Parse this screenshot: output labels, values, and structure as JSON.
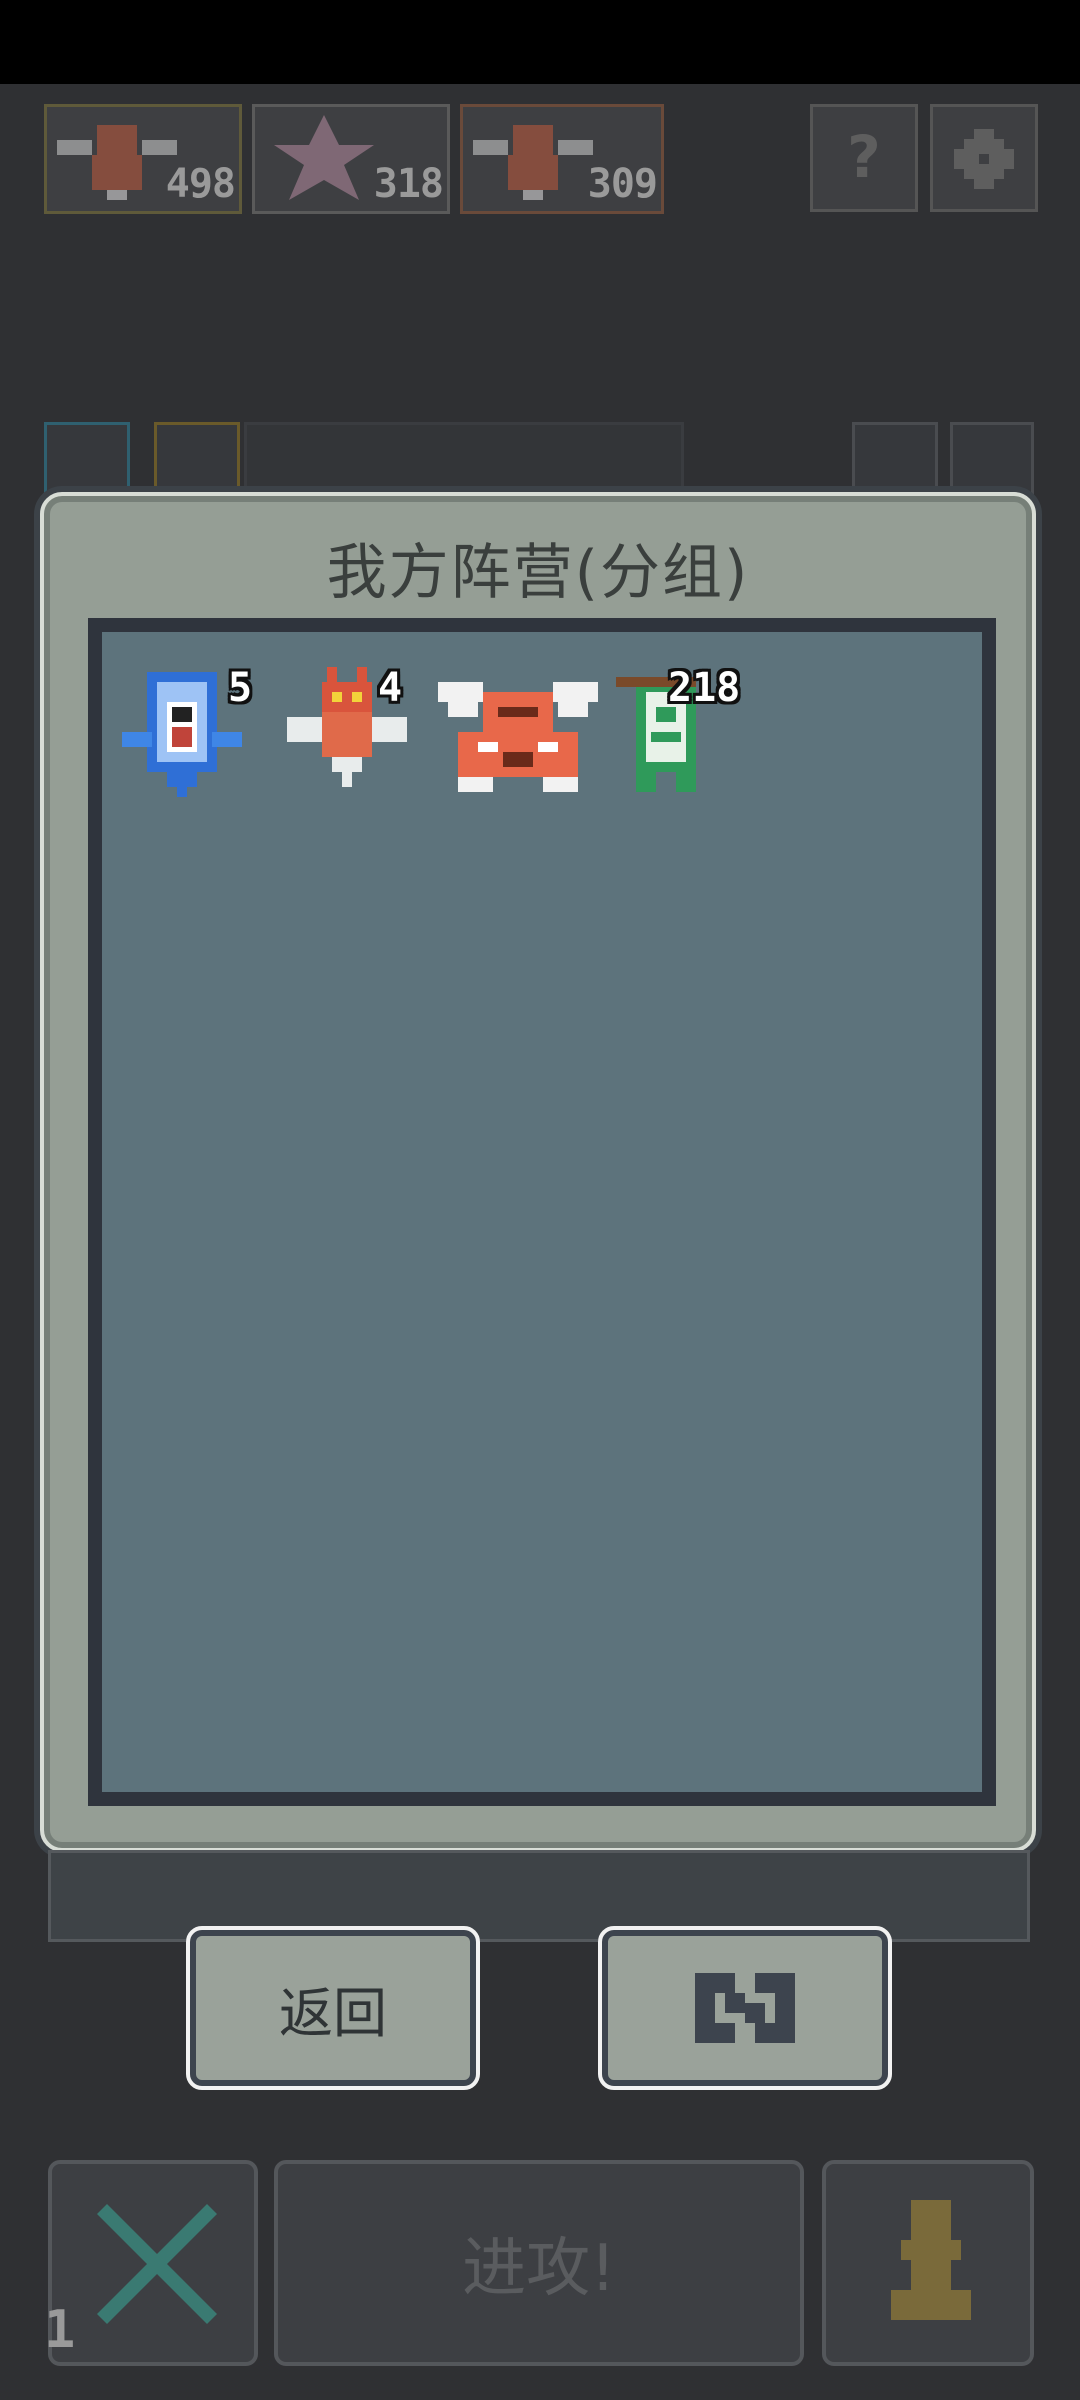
{
  "resources": [
    {
      "icon": "winged-dragon-icon",
      "count": "498"
    },
    {
      "icon": "star-icon",
      "count": "318"
    },
    {
      "icon": "winged-dragon-icon",
      "count": "309"
    }
  ],
  "top_buttons": {
    "help_label": "?",
    "settings_icon": "gear-icon"
  },
  "modal": {
    "title": "我方阵营(分组)",
    "units": [
      {
        "name": "blue-castle-unit",
        "count": "5"
      },
      {
        "name": "red-dragon-unit",
        "count": "4"
      },
      {
        "name": "winged-tiger-unit",
        "count": ""
      },
      {
        "name": "green-banner-unit",
        "count": "218"
      }
    ]
  },
  "buttons": {
    "back_label": "返回",
    "refresh_icon": "refresh-icon"
  },
  "bottom": {
    "attack_label": "进攻!",
    "level": "1"
  },
  "colors": {
    "panel": "#959e95",
    "roster_bg": "#5d737c",
    "frame": "#2f343d"
  }
}
